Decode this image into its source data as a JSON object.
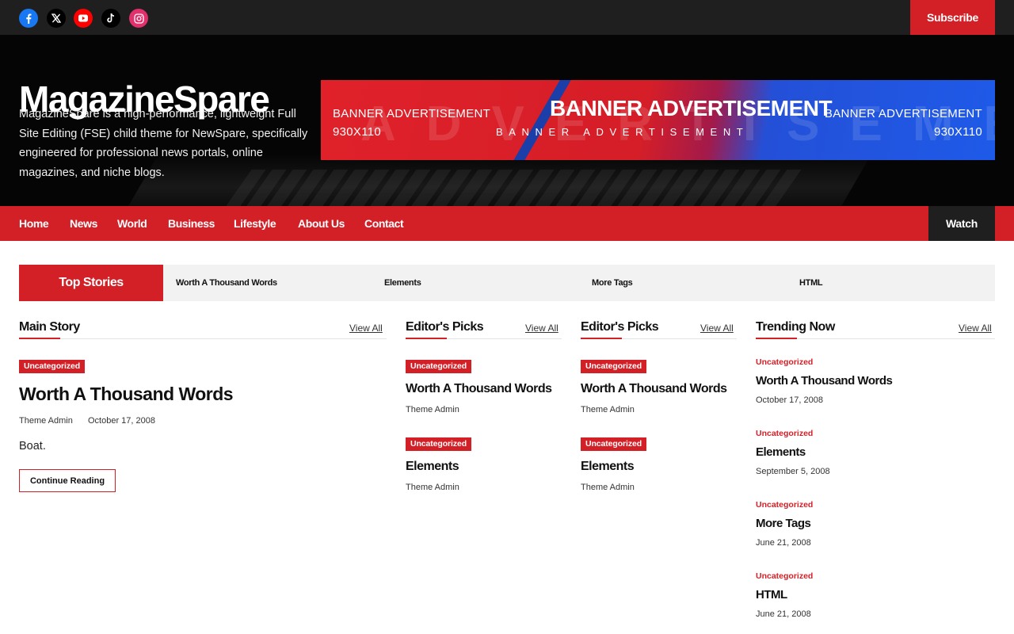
{
  "topbar": {
    "social": [
      {
        "name": "facebook-icon",
        "color": "#1877f2"
      },
      {
        "name": "x-icon",
        "color": "#000000"
      },
      {
        "name": "youtube-icon",
        "color": "#ff0000"
      },
      {
        "name": "tiktok-icon",
        "color": "#000000"
      },
      {
        "name": "instagram-icon",
        "color": "#e1306c"
      }
    ],
    "subscribe_label": "Subscribe"
  },
  "header": {
    "site_title": "MagazineSpare",
    "site_description": "MagazineSpare is a high-performance, lightweight Full Site Editing (FSE) child theme for NewSpare, specifically engineered for professional news portals, online magazines, and niche blogs.",
    "banner": {
      "left_line1": "BANNER ADVERTISEMENT",
      "left_line2": "930X110",
      "center_title": "BANNER ADVERTISEMENT",
      "center_sub": "BANNER ADVERTISEMENT",
      "right_line1": "BANNER ADVERTISEMENT",
      "right_line2": "930X110",
      "background_word": "ADVERTISEMENT"
    }
  },
  "nav": {
    "items": [
      "Home",
      "News",
      "World",
      "Business",
      "Lifestyle",
      "About Us",
      "Contact"
    ],
    "watch_label": "Watch"
  },
  "ticker": {
    "label": "Top Stories",
    "items": [
      "Worth A Thousand Words",
      "Elements",
      "More Tags",
      "HTML"
    ]
  },
  "main_story": {
    "heading": "Main Story",
    "view_all": "View All",
    "category": "Uncategorized",
    "title": "Worth A Thousand Words",
    "author": "Theme Admin",
    "date": "October 17, 2008",
    "excerpt": "Boat.",
    "continue_label": "Continue Reading"
  },
  "editors_picks_1": {
    "heading": "Editor's Picks",
    "view_all": "View All",
    "posts": [
      {
        "category": "Uncategorized",
        "title": "Worth A Thousand Words",
        "author": "Theme Admin"
      },
      {
        "category": "Uncategorized",
        "title": "Elements",
        "author": "Theme Admin"
      }
    ]
  },
  "editors_picks_2": {
    "heading": "Editor's Picks",
    "view_all": "View All",
    "posts": [
      {
        "category": "Uncategorized",
        "title": "Worth A Thousand Words",
        "author": "Theme Admin"
      },
      {
        "category": "Uncategorized",
        "title": "Elements",
        "author": "Theme Admin"
      }
    ]
  },
  "trending": {
    "heading": "Trending Now",
    "view_all": "View All",
    "posts": [
      {
        "category": "Uncategorized",
        "title": "Worth A Thousand Words",
        "date": "October 17, 2008"
      },
      {
        "category": "Uncategorized",
        "title": "Elements",
        "date": "September 5, 2008"
      },
      {
        "category": "Uncategorized",
        "title": "More Tags",
        "date": "June 21, 2008"
      },
      {
        "category": "Uncategorized",
        "title": "HTML",
        "date": "June 21, 2008"
      }
    ]
  },
  "colors": {
    "accent": "#d32027",
    "dark": "#1f1f1f"
  }
}
